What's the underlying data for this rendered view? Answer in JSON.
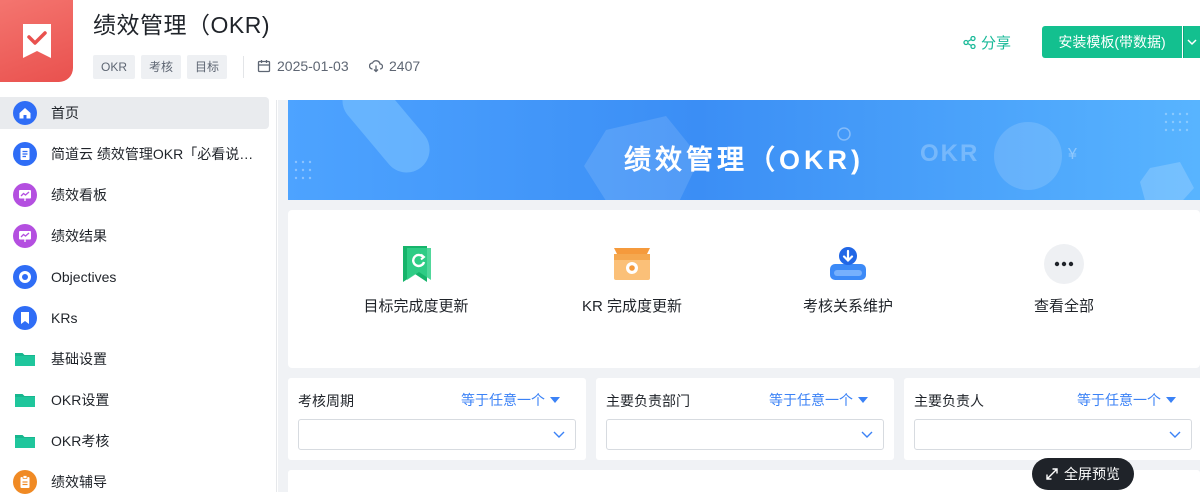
{
  "app": {
    "title": "绩效管理（OKR)",
    "tags": [
      "OKR",
      "考核",
      "目标"
    ],
    "date": "2025-01-03",
    "downloads": "2407",
    "share_label": "分享",
    "install_label": "安装模板(带数据)",
    "icon_color": "#e9514e"
  },
  "sidebar": {
    "items": [
      {
        "label": "首页",
        "icon": "home-icon",
        "color": "#2f6df6"
      },
      {
        "label": "简道云 绩效管理OKR「必看说明」",
        "icon": "document-icon",
        "color": "#2f6df6"
      },
      {
        "label": "绩效看板",
        "icon": "dashboard-icon",
        "color": "#b44fe0"
      },
      {
        "label": "绩效结果",
        "icon": "dashboard-icon",
        "color": "#b44fe0"
      },
      {
        "label": "Objectives",
        "icon": "target-icon",
        "color": "#2f6df6"
      },
      {
        "label": "KRs",
        "icon": "bookmark-icon",
        "color": "#2f6df6"
      },
      {
        "label": "基础设置",
        "icon": "folder-icon",
        "color": "#17b68e"
      },
      {
        "label": "OKR设置",
        "icon": "folder-icon",
        "color": "#17b68e"
      },
      {
        "label": "OKR考核",
        "icon": "folder-icon",
        "color": "#17b68e"
      },
      {
        "label": "绩效辅导",
        "icon": "clipboard-icon",
        "color": "#f08a24"
      }
    ]
  },
  "banner": {
    "title": "绩效管理（OKR)",
    "ghost_text": "OKR",
    "yen_glyph": "¥"
  },
  "quick_actions": [
    {
      "label": "目标完成度更新",
      "icon": "flag-refresh-icon"
    },
    {
      "label": "KR 完成度更新",
      "icon": "inbox-icon"
    },
    {
      "label": "考核关系维护",
      "icon": "user-download-icon"
    },
    {
      "label": "查看全部",
      "icon": "more-icon"
    }
  ],
  "filters": [
    {
      "label": "考核周期",
      "operator": "等于任意一个"
    },
    {
      "label": "主要负责部门",
      "operator": "等于任意一个"
    },
    {
      "label": "主要负责人",
      "operator": "等于任意一个"
    }
  ],
  "fullscreen_label": "全屏预览"
}
